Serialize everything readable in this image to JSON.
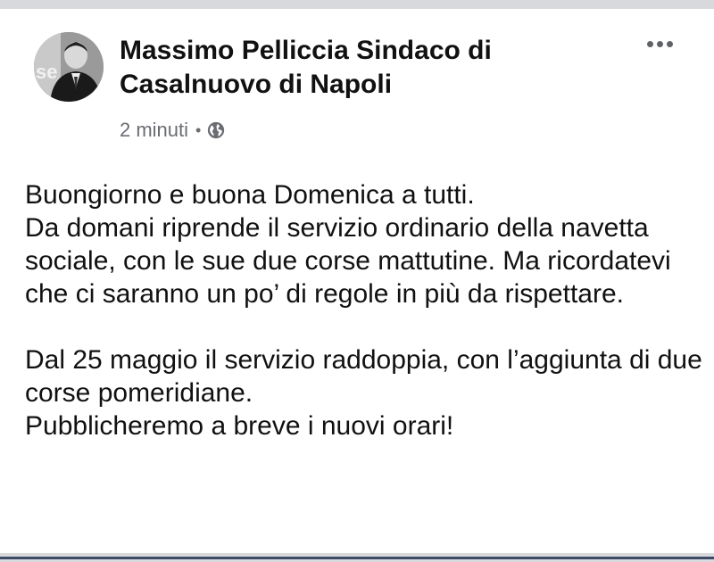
{
  "post": {
    "author": "Massimo Pelliccia Sindaco di Casalnuovo di Napoli",
    "time": "2 minuti",
    "separator": "•",
    "privacy_icon": "globe-icon",
    "more_icon": "more-horizontal-icon",
    "paragraphs": [
      "Buongiorno e buona Domenica a tutti.\nDa domani riprende il servizio ordinario della navetta sociale, con le sue due corse mattutine. Ma ricordatevi che ci saranno un po’ di regole in più da rispettare.",
      "Dal 25 maggio il servizio raddoppia, con l’aggiunta di due corse pomeridiane.\nPubblicheremo a breve i nuovi orari!"
    ]
  },
  "colors": {
    "text": "#111111",
    "meta": "#6a6d72",
    "band": "#d7d9dd",
    "accent_line": "#3c4a66"
  }
}
